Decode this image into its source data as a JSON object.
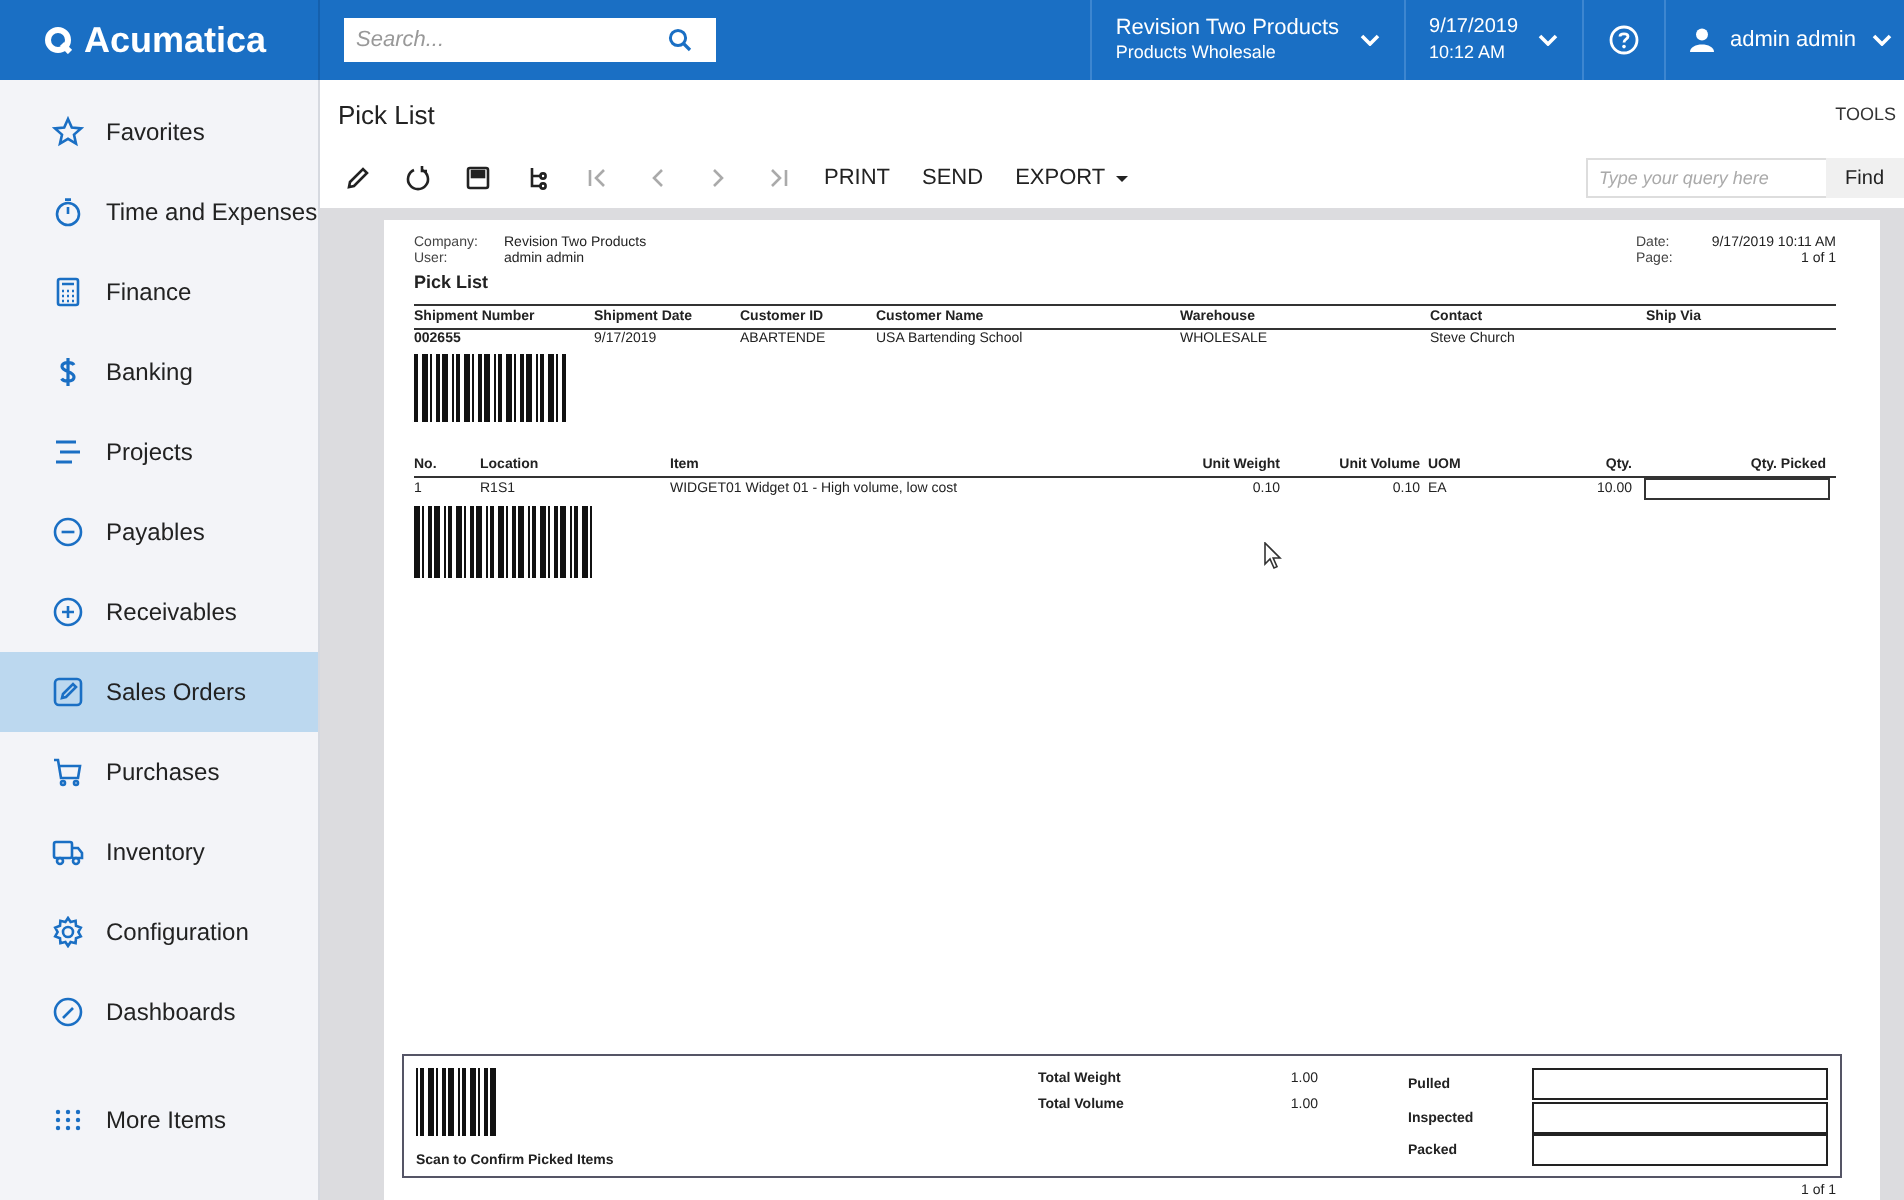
{
  "header": {
    "logo": "Acumatica",
    "search": {
      "placeholder": "Search..."
    },
    "company": {
      "name": "Revision Two Products",
      "branch": "Products Wholesale"
    },
    "datetime": {
      "date": "9/17/2019",
      "time": "10:12 AM"
    },
    "user": "admin admin"
  },
  "sidebar": {
    "items": [
      {
        "label": "Favorites",
        "selected": false
      },
      {
        "label": "Time and Expenses",
        "selected": false
      },
      {
        "label": "Finance",
        "selected": false
      },
      {
        "label": "Banking",
        "selected": false
      },
      {
        "label": "Projects",
        "selected": false
      },
      {
        "label": "Payables",
        "selected": false
      },
      {
        "label": "Receivables",
        "selected": false
      },
      {
        "label": "Sales Orders",
        "selected": true
      },
      {
        "label": "Purchases",
        "selected": false
      },
      {
        "label": "Inventory",
        "selected": false
      },
      {
        "label": "Configuration",
        "selected": false
      },
      {
        "label": "Dashboards",
        "selected": false
      },
      {
        "label": "More Items",
        "selected": false
      }
    ]
  },
  "screen": {
    "title": "Pick List",
    "tools": "TOOLS",
    "toolbar_icons": [
      {
        "disabled": false
      },
      {
        "disabled": false
      },
      {
        "disabled": false
      },
      {
        "disabled": false
      },
      {
        "disabled": true
      },
      {
        "disabled": true
      },
      {
        "disabled": true
      },
      {
        "disabled": true
      }
    ],
    "actions": [
      {
        "label": "PRINT",
        "menu": false
      },
      {
        "label": "SEND",
        "menu": false
      },
      {
        "label": "EXPORT",
        "menu": true
      }
    ],
    "query": {
      "placeholder": "Type your query here"
    },
    "find": "Find"
  },
  "report": {
    "meta": [
      {
        "label": "Company:",
        "value": "Revision Two Products"
      },
      {
        "label": "User:",
        "value": "admin admin"
      }
    ],
    "meta_right": [
      {
        "label": "Date:",
        "value": "9/17/2019 10:11 AM"
      },
      {
        "label": "Page:",
        "value": "1 of 1"
      }
    ],
    "title": "Pick List",
    "shipment_columns": [
      "Shipment Number",
      "Shipment Date",
      "Customer ID",
      "Customer Name",
      "Warehouse",
      "Contact",
      "Ship Via"
    ],
    "shipment_row": [
      "002655",
      "9/17/2019",
      "ABARTENDE",
      "USA Bartending School",
      "WHOLESALE",
      "Steve Church"
    ],
    "item_columns": [
      "No.",
      "Location",
      "Item",
      "Unit Weight",
      "Unit Volume",
      "UOM",
      "Qty.",
      "Qty. Picked"
    ],
    "item_rows": [
      {
        "cells": [
          "1",
          "R1S1",
          "WIDGET01  Widget 01 - High volume, low cost",
          "0.10",
          "0.10",
          "EA",
          "10.00"
        ]
      }
    ],
    "footer": {
      "scan_label": "Scan to Confirm Picked Items",
      "totals": [
        {
          "label": "Total Weight",
          "value": "1.00"
        },
        {
          "label": "Total Volume",
          "value": "1.00"
        }
      ],
      "checks": [
        "Pulled",
        "Inspected",
        "Packed"
      ]
    },
    "page_footer": "1 of 1"
  }
}
